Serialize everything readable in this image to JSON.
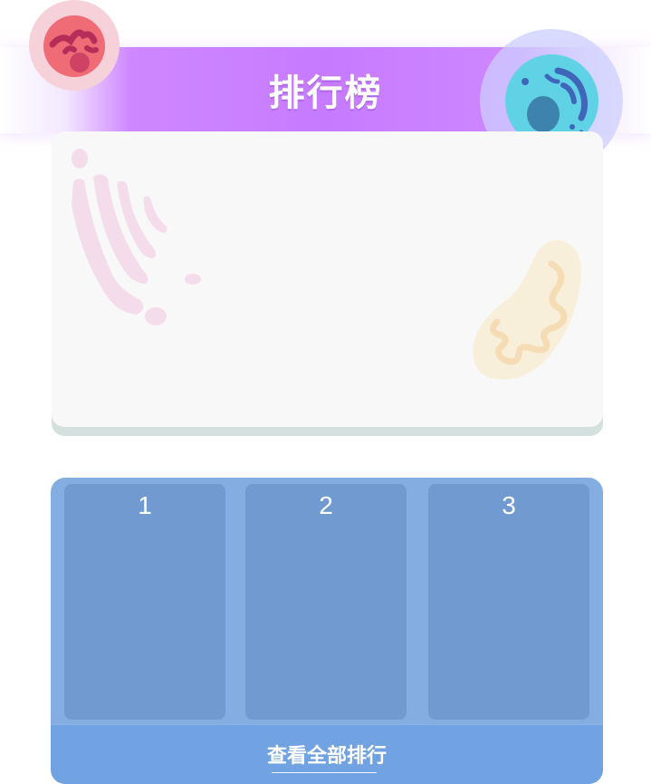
{
  "header": {
    "title": "排行榜"
  },
  "leaderboard": {
    "ranks": [
      {
        "label": "1"
      },
      {
        "label": "2"
      },
      {
        "label": "3"
      }
    ],
    "view_all_label": "查看全部排行"
  },
  "icons": {
    "top_left": "red-cell-icon",
    "top_right": "blue-cell-icon",
    "card_left": "golgi-icon",
    "card_right": "mitochondria-icon"
  },
  "colors": {
    "ribbon": "#c67bff",
    "panel": "#84aee2",
    "slot": "#719bd0",
    "footer": "#71a2e1",
    "card": "#f8f8f8"
  }
}
